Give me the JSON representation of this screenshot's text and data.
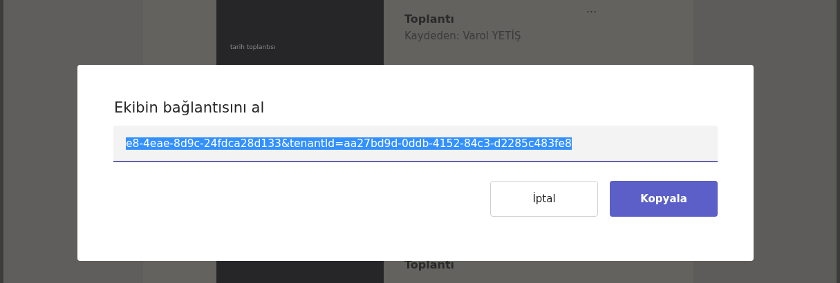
{
  "background_feed": {
    "cards": [
      {
        "thumbnail_caption": "tarih toplantısı",
        "title": "Toplantı",
        "recorded_by": "Kaydeden: Varol YETİŞ",
        "more": "···"
      },
      {
        "title": "Toplantı"
      }
    ]
  },
  "dialog": {
    "title": "Ekibin bağlantısını al",
    "link_field": {
      "value": "e8-4eae-8d9c-24fdca28d133&tenantId=aa27bd9d-0ddb-4152-84c3-d2285c483fe8",
      "text_selected": true
    },
    "buttons": [
      {
        "label": "İptal",
        "kind": "secondary"
      },
      {
        "label": "Kopyala",
        "kind": "primary"
      }
    ]
  }
}
